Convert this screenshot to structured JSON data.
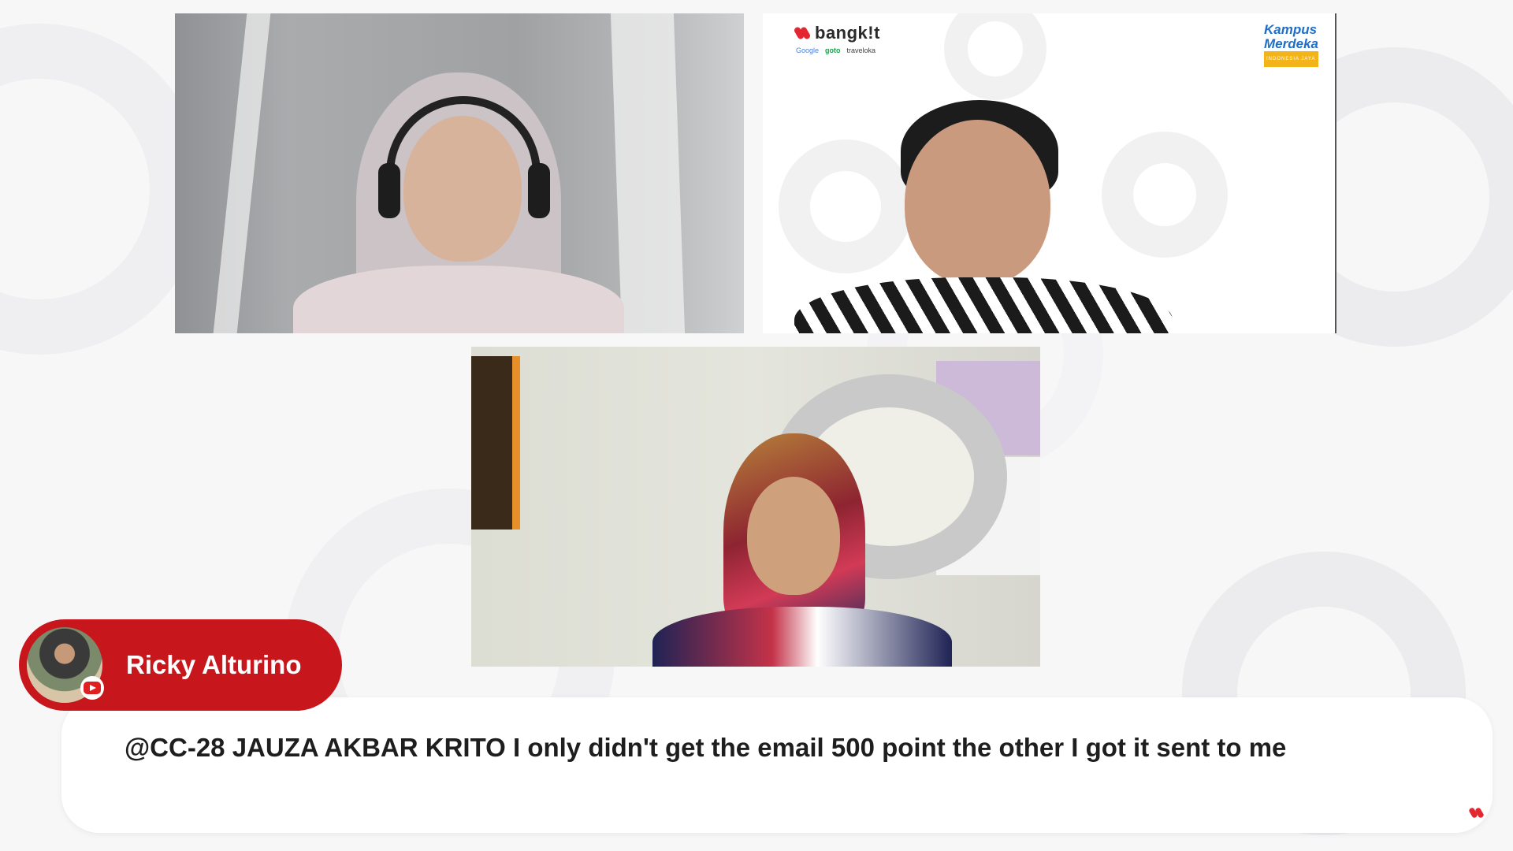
{
  "overlay": {
    "author": "Ricky Alturino",
    "message": "@CC-28 JAUZA AKBAR KRITO I only didn't get the email 500 point the other I got it sent to me",
    "platform_icon": "youtube-icon"
  },
  "branding": {
    "bangkit_label": "bangk!t",
    "partners": [
      "Google",
      "goto",
      "traveloka"
    ],
    "kampus_merdeka_line1": "Kampus",
    "kampus_merdeka_line2": "Merdeka",
    "kampus_merdeka_tagline": "INDONESIA JAYA"
  },
  "colors": {
    "accent_red": "#c8161d",
    "background": "#f7f7f8",
    "card": "#ffffff"
  }
}
